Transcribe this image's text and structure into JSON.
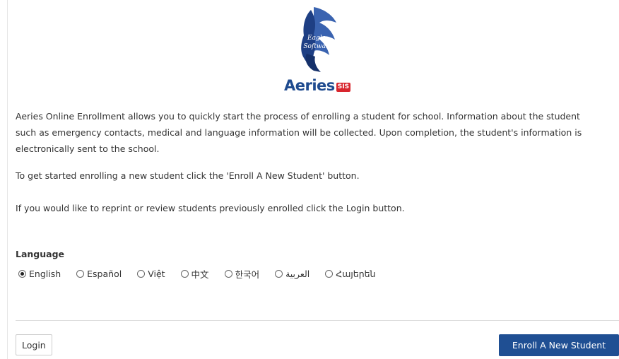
{
  "logo": {
    "brand_text": "Aeries",
    "badge_text": "SIS",
    "mascot_text_line1": "Eagle",
    "mascot_text_line2": "Software",
    "mark_color": "#2a4f9a",
    "badge_color": "#d8262e"
  },
  "intro": {
    "paragraph1": "Aeries Online Enrollment allows you to quickly start the process of enrolling a student for school. Information about the student such as emergency contacts, medical and language information will be collected. Upon completion, the student's information is electronically sent to the school.",
    "paragraph2": "To get started enrolling a new student click the 'Enroll A New Student' button.",
    "paragraph3": "If you would like to reprint or review students previously enrolled click the Login button."
  },
  "language": {
    "label": "Language",
    "selected": "English",
    "options": [
      {
        "label": "English",
        "checked": true
      },
      {
        "label": "Español",
        "checked": false
      },
      {
        "label": "Việt",
        "checked": false
      },
      {
        "label": "中文",
        "checked": false
      },
      {
        "label": "한국어",
        "checked": false
      },
      {
        "label": "العربية",
        "checked": false
      },
      {
        "label": "Հայերեն",
        "checked": false
      }
    ]
  },
  "actions": {
    "login_label": "Login",
    "enroll_label": "Enroll A New Student",
    "enroll_color": "#1f4f93"
  }
}
